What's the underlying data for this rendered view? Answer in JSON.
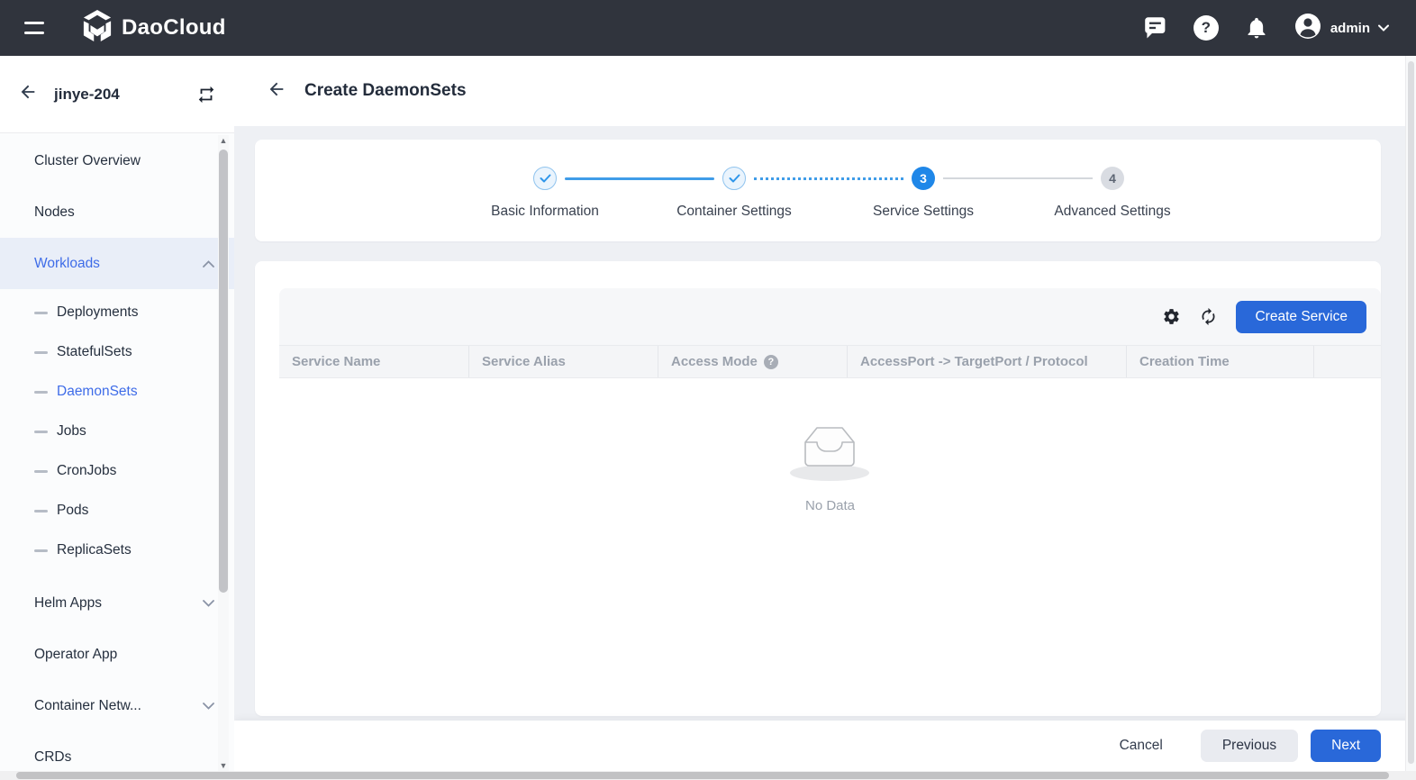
{
  "topbar": {
    "brand": "DaoCloud",
    "user_label": "admin"
  },
  "sidebar": {
    "cluster_name": "jinye-204",
    "items": [
      {
        "label": "Cluster Overview",
        "type": "item"
      },
      {
        "label": "Nodes",
        "type": "item"
      },
      {
        "label": "Workloads",
        "type": "group",
        "state": "expanded",
        "active": true
      },
      {
        "label": "Deployments",
        "type": "sub"
      },
      {
        "label": "StatefulSets",
        "type": "sub"
      },
      {
        "label": "DaemonSets",
        "type": "sub",
        "active": true
      },
      {
        "label": "Jobs",
        "type": "sub"
      },
      {
        "label": "CronJobs",
        "type": "sub"
      },
      {
        "label": "Pods",
        "type": "sub"
      },
      {
        "label": "ReplicaSets",
        "type": "sub"
      },
      {
        "label": "Helm Apps",
        "type": "group",
        "state": "collapsed"
      },
      {
        "label": "Operator App",
        "type": "item"
      },
      {
        "label": "Container Netw...",
        "type": "group",
        "state": "collapsed"
      },
      {
        "label": "CRDs",
        "type": "item"
      }
    ]
  },
  "page": {
    "title": "Create DaemonSets",
    "stepper": [
      {
        "label": "Basic Information",
        "status": "done",
        "connector": "solid-blue"
      },
      {
        "label": "Container Settings",
        "status": "done",
        "connector": "dotted-blue"
      },
      {
        "label": "Service Settings",
        "status": "active",
        "number": "3",
        "connector": "solid-gray"
      },
      {
        "label": "Advanced Settings",
        "status": "pending",
        "number": "4",
        "connector": ""
      }
    ],
    "toolbar": {
      "create_service_label": "Create Service"
    },
    "table": {
      "columns": [
        {
          "label": "Service Name",
          "help": false
        },
        {
          "label": "Service Alias",
          "help": false
        },
        {
          "label": "Access Mode",
          "help": true
        },
        {
          "label": "AccessPort -> TargetPort / Protocol",
          "help": false
        },
        {
          "label": "Creation Time",
          "help": false
        },
        {
          "label": "",
          "help": false
        }
      ],
      "rows": [],
      "empty_text": "No Data"
    },
    "footer": {
      "cancel_label": "Cancel",
      "previous_label": "Previous",
      "next_label": "Next"
    }
  },
  "colors": {
    "topbar_bg": "#30343d",
    "accent_blue": "#2968d9",
    "active_step_blue": "#1f87e8",
    "link_blue": "#3e6ce8"
  }
}
